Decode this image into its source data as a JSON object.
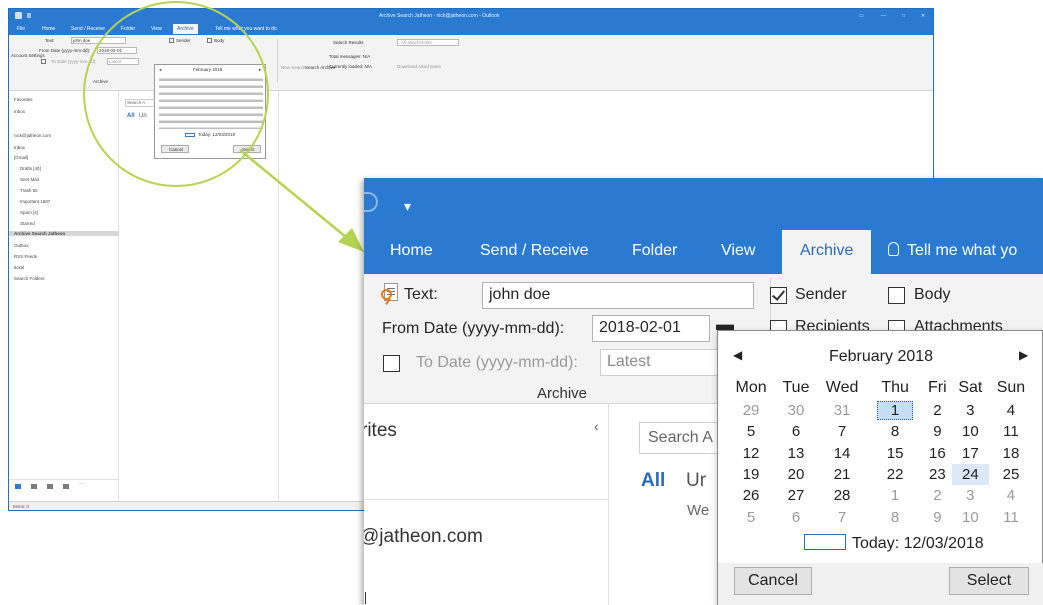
{
  "background_window": {
    "title": "Archive Search Jatheon - nick@jatheon.com - Outlook",
    "tabs": [
      "File",
      "Home",
      "Send / Receive",
      "Folder",
      "View",
      "Archive",
      "Tell me what you want to do"
    ],
    "ribbon": {
      "account_settings": "Account Settings",
      "text_label": "Text:",
      "text_value": "john doe",
      "from_label": "From Date (yyyy-mm-dd):",
      "from_value": "2018-02-01",
      "to_label": "To Date (yyyy-mm-dd):",
      "to_value": "Latest",
      "sender": "Sender",
      "body": "Body",
      "group_label": "Archive",
      "new_search": "New Search",
      "search_archive": "Search Archive",
      "search_results": "Search Results",
      "all_attachments": "All attachments",
      "total_messages": "Total messages: N/A",
      "currently_loaded": "Currently loaded: N/A",
      "download": "Download Attachment"
    },
    "nav": {
      "favorites": "Favorites",
      "inbox": "Inbox",
      "account": "nick@jatheon.com",
      "items": [
        "Inbox",
        "[Gmail]",
        "Drafts [40]",
        "Sent Mail",
        "Trash 55",
        "Important 1687",
        "Spam [4]",
        "Starred",
        "Archive Search Jatheon",
        "Outbox",
        "RSS Feeds",
        "tickel",
        "Search Folders"
      ],
      "selected": "Archive Search Jatheon"
    },
    "list": {
      "search": "Search A",
      "all": "All",
      "unread": "Un"
    },
    "mini_calendar": {
      "month": "February 2018",
      "today": "Today: 12/03/2018",
      "cancel": "Cancel",
      "select": "Select"
    },
    "status": "Items: 0"
  },
  "zoom": {
    "quick_access": "≡",
    "tabs": [
      {
        "label": "Home"
      },
      {
        "label": "Send / Receive"
      },
      {
        "label": "Folder"
      },
      {
        "label": "View"
      },
      {
        "label": "Archive"
      }
    ],
    "tell_me": "Tell me what yo",
    "text_label": "Text:",
    "text_value": "john doe",
    "from_label": "From Date (yyyy-mm-dd):",
    "from_value": "2018-02-01",
    "to_label": "To Date (yyyy-mm-dd):",
    "to_value": "Latest",
    "sender_label": "Sender",
    "body_label": "Body",
    "recipients_label": "Recipients",
    "attachments_label": "Attachments",
    "group_label": "Archive",
    "nav_favorites": "rites",
    "nav_account": "@jatheon.com",
    "search_placeholder": "Search A",
    "filter_all": "All",
    "filter_unread": "Ur",
    "list_hint": "We",
    "calendar": {
      "month": "February 2018",
      "prev": "◀",
      "next": "▶",
      "weekdays": [
        "Mon",
        "Tue",
        "Wed",
        "Thu",
        "Fri",
        "Sat",
        "Sun"
      ],
      "weeks": [
        [
          "29",
          "30",
          "31",
          "1",
          "2",
          "3",
          "4"
        ],
        [
          "5",
          "6",
          "7",
          "8",
          "9",
          "10",
          "11"
        ],
        [
          "12",
          "13",
          "14",
          "15",
          "16",
          "17",
          "18"
        ],
        [
          "19",
          "20",
          "21",
          "22",
          "23",
          "24",
          "25"
        ],
        [
          "26",
          "27",
          "28",
          "1",
          "2",
          "3",
          "4"
        ],
        [
          "5",
          "6",
          "7",
          "8",
          "9",
          "10",
          "11"
        ]
      ],
      "selected_date": "1",
      "today_label": "Today: 12/03/2018",
      "cancel": "Cancel",
      "select": "Select"
    }
  },
  "colors": {
    "accent": "#2b7ad1",
    "highlight": "#b5d251"
  }
}
